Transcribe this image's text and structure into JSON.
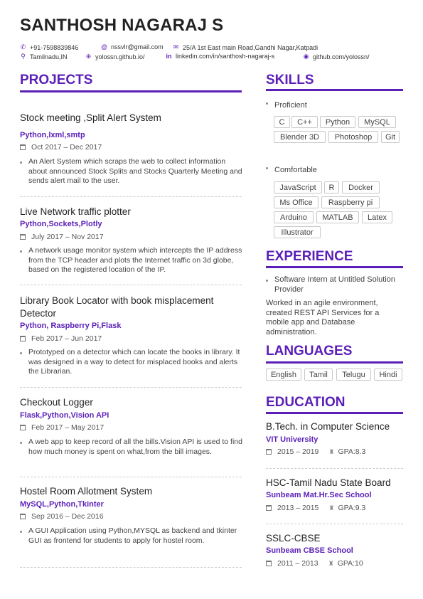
{
  "header": {
    "name": "SANTHOSH NAGARAJ S",
    "phone": "+91-7598839846",
    "email": "nssvlr@gmail.com",
    "address": "25/A 1st East main Road,Gandhi Nagar,Katpadi",
    "location": "Tamilnadu,IN",
    "website": "yolossn.github.io/",
    "linkedin": "linkedin.com/in/santhosh-nagaraj-s",
    "github": "github.com/yolossn/"
  },
  "projects": {
    "title": "PROJECTS",
    "items": [
      {
        "title": "Stock meeting ,Split Alert System",
        "tech": "Python,lxml,smtp",
        "date": "Oct 2017 – Dec 2017",
        "desc": "An Alert System which scraps the web to collect information about announced Stock Splits and Stocks Quarterly Meeting and sends alert mail to the user."
      },
      {
        "title": "Live Network traffic plotter",
        "tech": "Python,Sockets,Plotly",
        "date": "July 2017 – Nov 2017",
        "desc": "A network usage monitor system which intercepts the IP address from the TCP header and plots the Internet traffic on 3d globe, based on the registered location of the IP."
      },
      {
        "title": "Library Book Locator with book misplacement Detector",
        "tech": "Python, Raspberry Pi,Flask",
        "date": "Feb 2017 – Jun 2017",
        "desc": "Prototyped on a detector which can locate the books in library. It was designed in a way to detect for misplaced books and alerts the Librarian."
      },
      {
        "title": "Checkout Logger",
        "tech": "Flask,Python,Vision API",
        "date": "Feb 2017 – May 2017",
        "desc": "A web app to keep record of all the bills.Vision API is used to find how much money is spent on what,from the bill images."
      },
      {
        "title": "Hostel Room Allotment System",
        "tech": "MySQL,Python,Tkinter",
        "date": "Sep 2016 – Dec 2016",
        "desc": "A GUI Application using Python,MYSQL as backend and tkinter GUI as frontend for students to apply for hostel room."
      }
    ]
  },
  "skills": {
    "title": "SKILLS",
    "proficient_label": "Proficient",
    "proficient": [
      "C",
      "C++",
      "Python",
      "MySQL",
      "Blender 3D",
      "Photoshop",
      "Git"
    ],
    "comfortable_label": "Comfortable",
    "comfortable": [
      "JavaScript",
      "R",
      "Docker",
      "Ms Office",
      "Raspberry pi",
      "Arduino",
      "MATLAB",
      "Latex",
      "Illustrator"
    ]
  },
  "experience": {
    "title": "EXPERIENCE",
    "role": "Software Intern at Untitled Solution Provider",
    "desc": "Worked in an agile environment, created REST API Services for a mobile app and Database administration."
  },
  "languages": {
    "title": "LANGUAGES",
    "items": [
      "English",
      "Tamil",
      "Telugu",
      "Hindi"
    ]
  },
  "education": {
    "title": "EDUCATION",
    "items": [
      {
        "degree": "B.Tech. in Computer Science",
        "school": "VIT University",
        "years": "2015 – 2019",
        "gpa": "GPA:8.3"
      },
      {
        "degree": "HSC-Tamil Nadu State Board",
        "school": "Sunbeam Mat.Hr.Sec School",
        "years": "2013 – 2015",
        "gpa": "GPA:9.3"
      },
      {
        "degree": "SSLC-CBSE",
        "school": "Sunbeam CBSE School",
        "years": "2011 – 2013",
        "gpa": "GPA:10"
      }
    ]
  },
  "icons": [
    "phone-icon",
    "at-icon",
    "envelope-icon",
    "map-pin-icon",
    "link-icon",
    "linkedin-icon",
    "github-icon",
    "calendar-icon",
    "trophy-icon"
  ],
  "colors": {
    "accent": "#5b1fb8",
    "text": "#333333"
  }
}
